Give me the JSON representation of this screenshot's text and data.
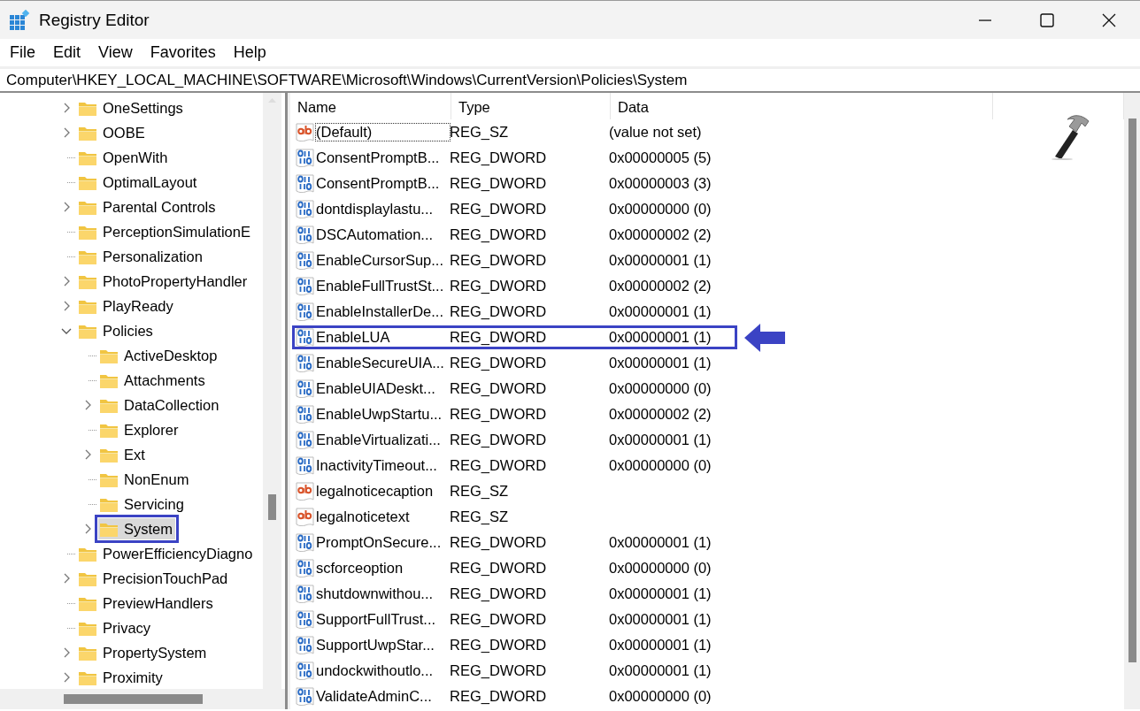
{
  "window": {
    "title": "Registry Editor"
  },
  "menu": [
    "File",
    "Edit",
    "View",
    "Favorites",
    "Help"
  ],
  "address": "Computer\\HKEY_LOCAL_MACHINE\\SOFTWARE\\Microsoft\\Windows\\CurrentVersion\\Policies\\System",
  "tree": {
    "items": [
      {
        "label": "OneSettings",
        "expanded": false,
        "selected": false,
        "highlighted": false
      },
      {
        "label": "OOBE",
        "expanded": false,
        "selected": false,
        "highlighted": false
      },
      {
        "label": "OpenWith",
        "selected": false,
        "highlighted": false
      },
      {
        "label": "OptimalLayout",
        "selected": false,
        "highlighted": false
      },
      {
        "label": "Parental Controls",
        "expanded": false,
        "selected": false,
        "highlighted": false
      },
      {
        "label": "PerceptionSimulationE",
        "selected": false,
        "highlighted": false
      },
      {
        "label": "Personalization",
        "selected": false,
        "highlighted": false
      },
      {
        "label": "PhotoPropertyHandler",
        "expanded": false,
        "selected": false,
        "highlighted": false
      },
      {
        "label": "PlayReady",
        "expanded": false,
        "selected": false,
        "highlighted": false
      },
      {
        "label": "Policies",
        "expanded": true,
        "selected": false,
        "highlighted": false,
        "children": [
          {
            "label": "ActiveDesktop",
            "selected": false,
            "highlighted": false
          },
          {
            "label": "Attachments",
            "selected": false,
            "highlighted": false
          },
          {
            "label": "DataCollection",
            "expanded": false,
            "selected": false,
            "highlighted": false
          },
          {
            "label": "Explorer",
            "selected": false,
            "highlighted": false
          },
          {
            "label": "Ext",
            "expanded": false,
            "selected": false,
            "highlighted": false
          },
          {
            "label": "NonEnum",
            "selected": false,
            "highlighted": false
          },
          {
            "label": "Servicing",
            "selected": false,
            "highlighted": false
          },
          {
            "label": "System",
            "expanded": false,
            "selected": true,
            "highlighted": true
          }
        ]
      },
      {
        "label": "PowerEfficiencyDiagno",
        "selected": false,
        "highlighted": false
      },
      {
        "label": "PrecisionTouchPad",
        "expanded": false,
        "selected": false,
        "highlighted": false
      },
      {
        "label": "PreviewHandlers",
        "selected": false,
        "highlighted": false
      },
      {
        "label": "Privacy",
        "selected": false,
        "highlighted": false
      },
      {
        "label": "PropertySystem",
        "expanded": false,
        "selected": false,
        "highlighted": false
      },
      {
        "label": "Proximity",
        "expanded": false,
        "selected": false,
        "highlighted": false
      }
    ]
  },
  "values": {
    "columns": [
      "Name",
      "Type",
      "Data"
    ],
    "rows": [
      {
        "kind": "string",
        "name": "(Default)",
        "type": "REG_SZ",
        "data": "(value not set)",
        "highlighted": false
      },
      {
        "kind": "dword",
        "name": "ConsentPromptB...",
        "type": "REG_DWORD",
        "data": "0x00000005 (5)",
        "highlighted": false
      },
      {
        "kind": "dword",
        "name": "ConsentPromptB...",
        "type": "REG_DWORD",
        "data": "0x00000003 (3)",
        "highlighted": false
      },
      {
        "kind": "dword",
        "name": "dontdisplaylastu...",
        "type": "REG_DWORD",
        "data": "0x00000000 (0)",
        "highlighted": false
      },
      {
        "kind": "dword",
        "name": "DSCAutomation...",
        "type": "REG_DWORD",
        "data": "0x00000002 (2)",
        "highlighted": false
      },
      {
        "kind": "dword",
        "name": "EnableCursorSup...",
        "type": "REG_DWORD",
        "data": "0x00000001 (1)",
        "highlighted": false
      },
      {
        "kind": "dword",
        "name": "EnableFullTrustSt...",
        "type": "REG_DWORD",
        "data": "0x00000002 (2)",
        "highlighted": false
      },
      {
        "kind": "dword",
        "name": "EnableInstallerDe...",
        "type": "REG_DWORD",
        "data": "0x00000001 (1)",
        "highlighted": false
      },
      {
        "kind": "dword",
        "name": "EnableLUA",
        "type": "REG_DWORD",
        "data": "0x00000001 (1)",
        "highlighted": true
      },
      {
        "kind": "dword",
        "name": "EnableSecureUIA...",
        "type": "REG_DWORD",
        "data": "0x00000001 (1)",
        "highlighted": false
      },
      {
        "kind": "dword",
        "name": "EnableUIADeskt...",
        "type": "REG_DWORD",
        "data": "0x00000000 (0)",
        "highlighted": false
      },
      {
        "kind": "dword",
        "name": "EnableUwpStartu...",
        "type": "REG_DWORD",
        "data": "0x00000002 (2)",
        "highlighted": false
      },
      {
        "kind": "dword",
        "name": "EnableVirtualizati...",
        "type": "REG_DWORD",
        "data": "0x00000001 (1)",
        "highlighted": false
      },
      {
        "kind": "dword",
        "name": "InactivityTimeout...",
        "type": "REG_DWORD",
        "data": "0x00000000 (0)",
        "highlighted": false
      },
      {
        "kind": "string",
        "name": "legalnoticecaption",
        "type": "REG_SZ",
        "highlighted": false
      },
      {
        "kind": "string",
        "name": "legalnoticetext",
        "type": "REG_SZ",
        "highlighted": false
      },
      {
        "kind": "dword",
        "name": "PromptOnSecure...",
        "type": "REG_DWORD",
        "data": "0x00000001 (1)",
        "highlighted": false
      },
      {
        "kind": "dword",
        "name": "scforceoption",
        "type": "REG_DWORD",
        "data": "0x00000000 (0)",
        "highlighted": false
      },
      {
        "kind": "dword",
        "name": "shutdownwithou...",
        "type": "REG_DWORD",
        "data": "0x00000001 (1)",
        "highlighted": false
      },
      {
        "kind": "dword",
        "name": "SupportFullTrust...",
        "type": "REG_DWORD",
        "data": "0x00000001 (1)",
        "highlighted": false
      },
      {
        "kind": "dword",
        "name": "SupportUwpStar...",
        "type": "REG_DWORD",
        "data": "0x00000001 (1)",
        "highlighted": false
      },
      {
        "kind": "dword",
        "name": "undockwithoutlo...",
        "type": "REG_DWORD",
        "data": "0x00000001 (1)",
        "highlighted": false
      },
      {
        "kind": "dword",
        "name": "ValidateAdminC...",
        "type": "REG_DWORD",
        "data": "0x00000000 (0)",
        "highlighted": false
      }
    ]
  }
}
